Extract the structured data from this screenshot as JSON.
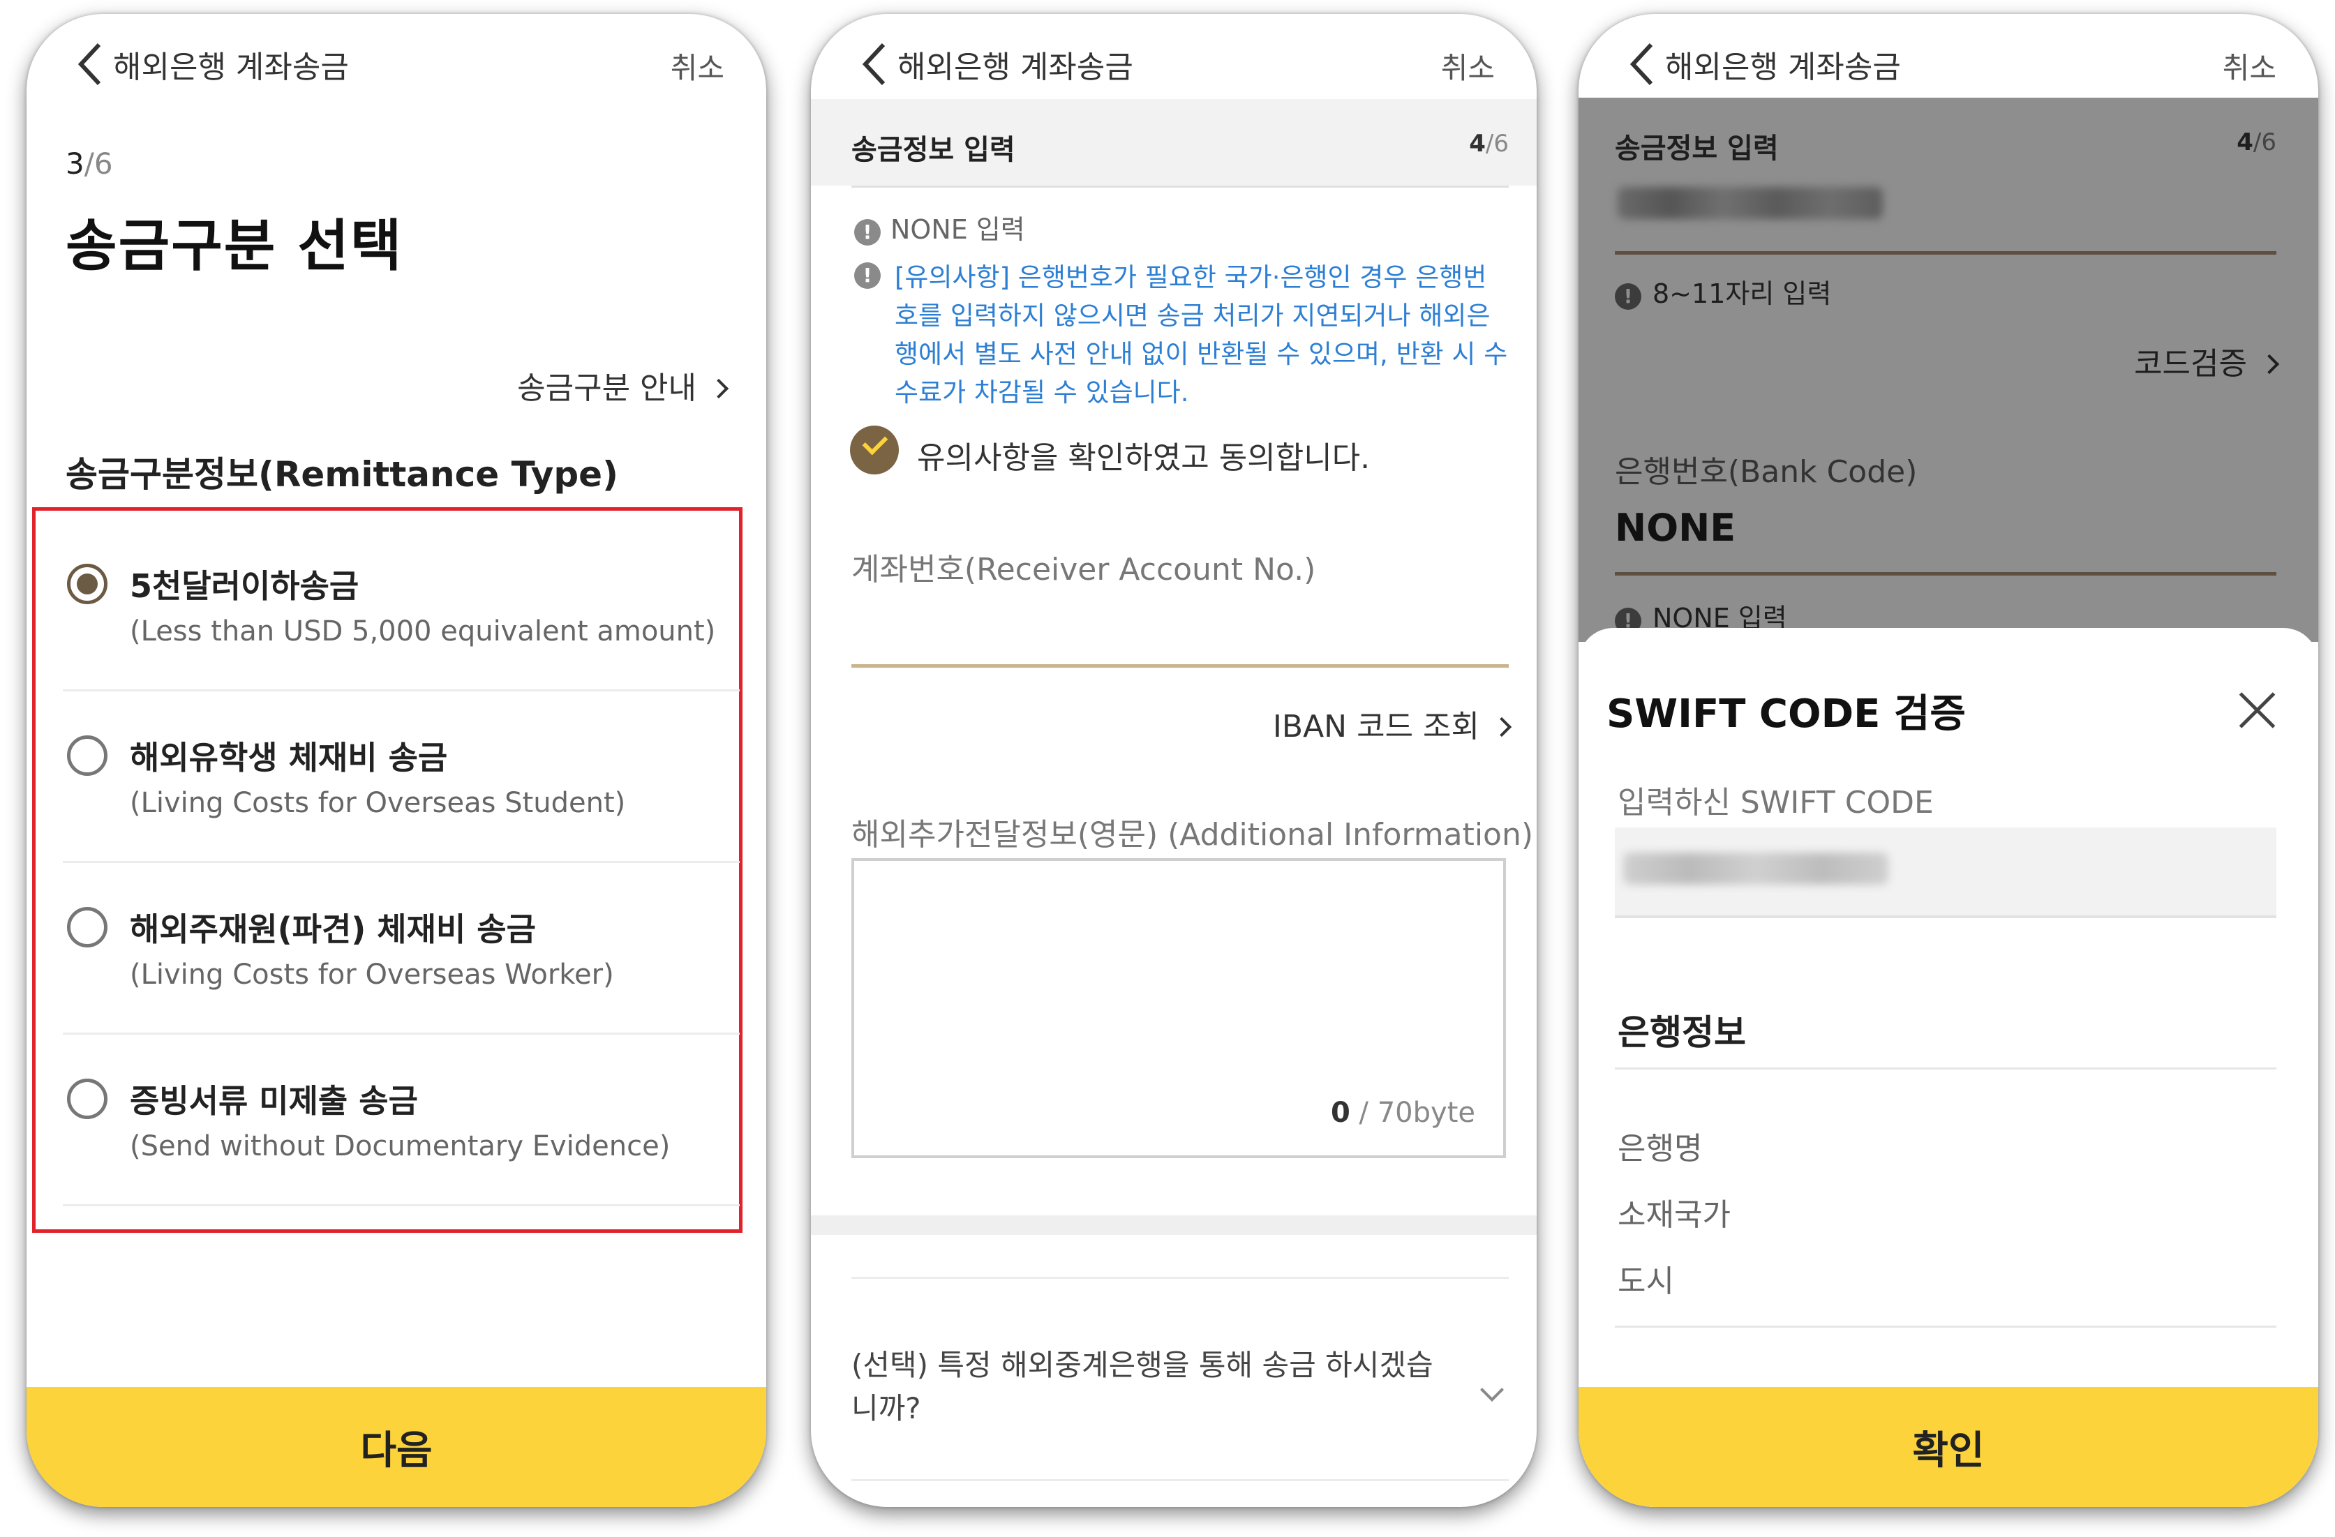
{
  "screen1": {
    "header": {
      "title": "해외은행 계좌송금",
      "cancel": "취소"
    },
    "step": {
      "current": "3",
      "separator": "/",
      "total": "6"
    },
    "title": "송금구분 선택",
    "guide_link": "송금구분 안내",
    "section_title": "송금구분정보(Remittance Type)",
    "options": [
      {
        "label": "5천달러이하송금",
        "sub": "(Less than USD 5,000 equivalent amount)",
        "selected": true
      },
      {
        "label": "해외유학생 체재비 송금",
        "sub": "(Living Costs for Overseas Student)",
        "selected": false
      },
      {
        "label": "해외주재원(파견) 체재비 송금",
        "sub": "(Living Costs for Overseas Worker)",
        "selected": false
      },
      {
        "label": "증빙서류 미제출 송금",
        "sub": "(Send without Documentary Evidence)",
        "selected": false
      }
    ],
    "next_button": "다음"
  },
  "screen2": {
    "header": {
      "title": "해외은행 계좌송금",
      "cancel": "취소"
    },
    "section": {
      "title": "송금정보 입력",
      "step_current": "4",
      "step_separator": "/",
      "step_total": "6"
    },
    "none_note": "NONE 입력",
    "warning": "[유의사항] 은행번호가 필요한 국가·은행인 경우 은행번호를 입력하지 않으시면 송금 처리가 지연되거나 해외은행에서 별도 사전 안내 없이 반환될 수 있으며, 반환 시 수수료가 차감될 수 있습니다.",
    "agree": {
      "label": "유의사항을 확인하였고 동의합니다.",
      "checked": true
    },
    "account_label": "계좌번호(Receiver Account No.)",
    "account_value": "",
    "iban_link": "IBAN 코드 조회",
    "additional_label": "해외추가전달정보(영문) (Additional Information)",
    "additional_value": "",
    "counter": {
      "count": "0",
      "limit": " / 70byte"
    },
    "optional_question": "(선택) 특정 해외중계은행을 통해 송금 하시겠습니까?"
  },
  "screen3": {
    "header": {
      "title": "해외은행 계좌송금",
      "cancel": "취소"
    },
    "section": {
      "title": "송금정보 입력",
      "step_current": "4",
      "step_separator": "/",
      "step_total": "6"
    },
    "swift_note": "8~11자리 입력",
    "code_check": "코드검증",
    "bank_code_label": "은행번호(Bank Code)",
    "bank_code_value": "NONE",
    "none_note": "NONE 입력",
    "sheet": {
      "title": "SWIFT CODE 검증",
      "entered_label": "입력하신 SWIFT CODE",
      "bank_info_title": "은행정보",
      "fields": [
        "은행명",
        "소재국가",
        "도시"
      ]
    },
    "confirm_button": "확인"
  },
  "colors": {
    "accent_yellow": "#fcd33a",
    "gold_line": "#c9b48e",
    "radio_brown": "#6b5a44",
    "warning_blue": "#2d7fd4",
    "highlight_red": "#e0222b"
  }
}
